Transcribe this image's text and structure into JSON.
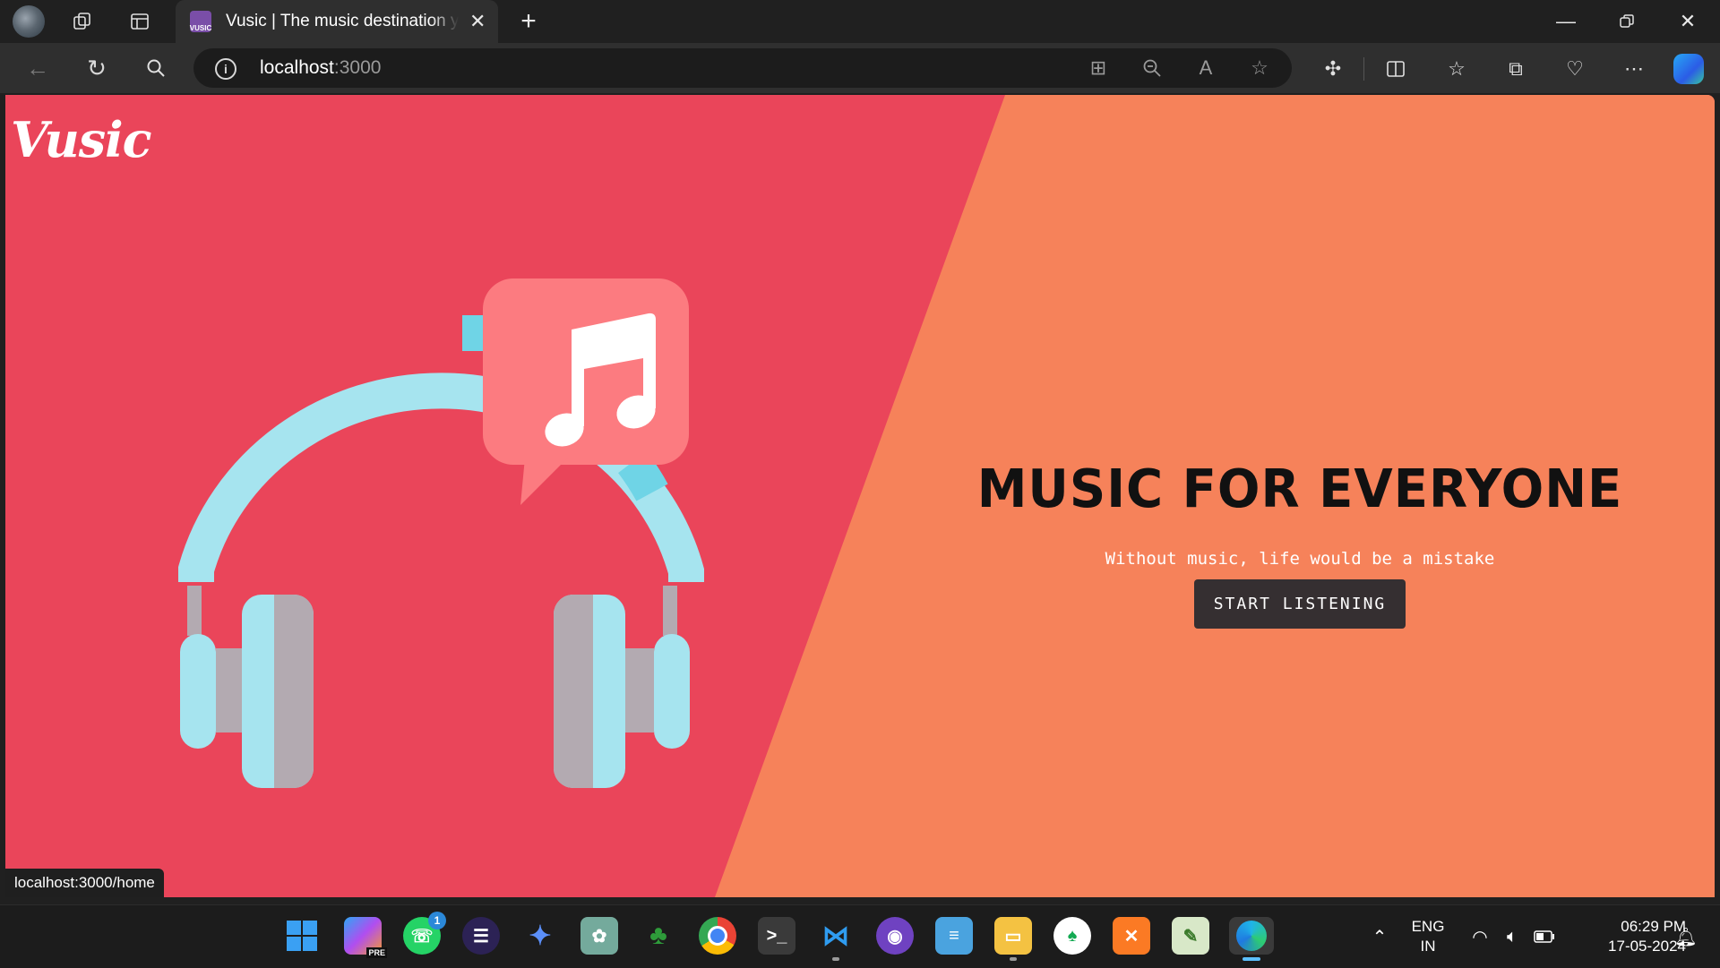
{
  "browser": {
    "tab_title": "Vusic | The music destination you",
    "favicon_text": "VUSIC",
    "url_host": "localhost",
    "url_port": ":3000",
    "status_url": "localhost:3000/home"
  },
  "page": {
    "logo": "Vusic",
    "hero_title": "MUSIC FOR EVERYONE",
    "hero_subtitle": "Without music, life would be a mistake",
    "cta_label": "START LISTENING",
    "colors": {
      "left_bg": "#ea455a",
      "right_bg": "#f6825a",
      "cta_bg": "#352f31",
      "headphone_band": "#a6e4ef",
      "cushion": "#b3aab1",
      "bubble": "#fc7b80"
    }
  },
  "taskbar": {
    "whatsapp_badge": "1",
    "copilot_badge": "PRE",
    "lang_line1": "ENG",
    "lang_line2": "IN",
    "time": "06:29 PM",
    "date": "17-05-2024"
  }
}
